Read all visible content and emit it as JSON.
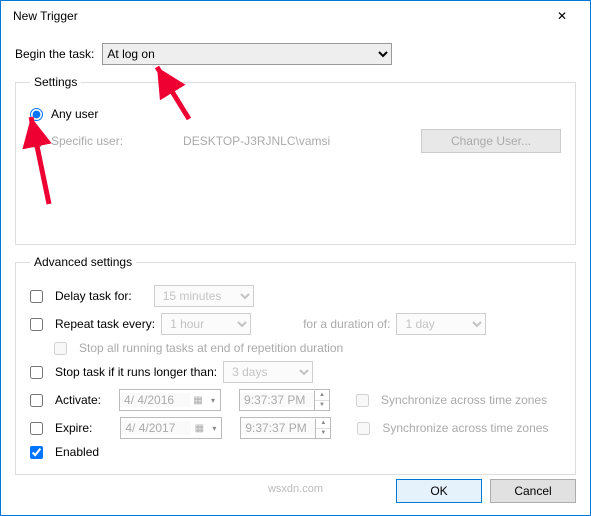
{
  "window": {
    "title": "New Trigger"
  },
  "begin": {
    "label": "Begin the task:",
    "value": "At log on"
  },
  "settings": {
    "legend": "Settings",
    "anyUser": {
      "label": "Any user",
      "checked": true
    },
    "specificUser": {
      "label": "Specific user:",
      "value": "DESKTOP-J3RJNLC\\vamsi",
      "checked": false
    },
    "changeUser": "Change User..."
  },
  "advanced": {
    "legend": "Advanced settings",
    "delay": {
      "label": "Delay task for:",
      "value": "15 minutes",
      "checked": false
    },
    "repeat": {
      "label": "Repeat task every:",
      "value": "1 hour",
      "checked": false,
      "durationLabel": "for a duration of:",
      "durationValue": "1 day"
    },
    "stopAll": {
      "label": "Stop all running tasks at end of repetition duration",
      "checked": false
    },
    "stopLonger": {
      "label": "Stop task if it runs longer than:",
      "value": "3 days",
      "checked": false
    },
    "activate": {
      "label": "Activate:",
      "date": "4/ 4/2016",
      "time": "9:37:37 PM",
      "sync": "Synchronize across time zones",
      "checked": false
    },
    "expire": {
      "label": "Expire:",
      "date": "4/ 4/2017",
      "time": "9:37:37 PM",
      "sync": "Synchronize across time zones",
      "checked": false
    },
    "enabled": {
      "label": "Enabled",
      "checked": true
    }
  },
  "buttons": {
    "ok": "OK",
    "cancel": "Cancel"
  },
  "watermark": "wsxdn.com"
}
